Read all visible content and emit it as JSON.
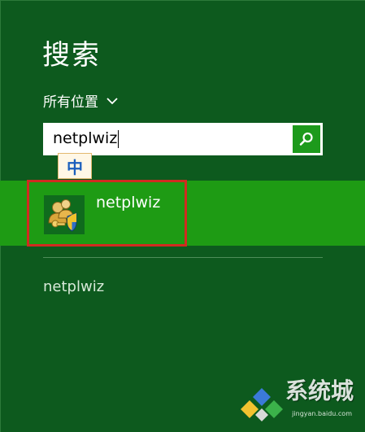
{
  "panel": {
    "title": "搜索",
    "scope_label": "所有位置"
  },
  "search": {
    "value": "netplwiz"
  },
  "ime": {
    "mode_label": "中"
  },
  "results": [
    {
      "label": "netplwiz"
    }
  ],
  "suggestions": [
    {
      "label": "netplwiz"
    }
  ],
  "watermark": {
    "text": "系统城",
    "subtext": "jingyan.baidu.com"
  },
  "colors": {
    "background": "#0d5a1e",
    "result_band": "#1e9b14",
    "search_button": "#1d9a1c",
    "highlight_border": "#d12b20"
  }
}
